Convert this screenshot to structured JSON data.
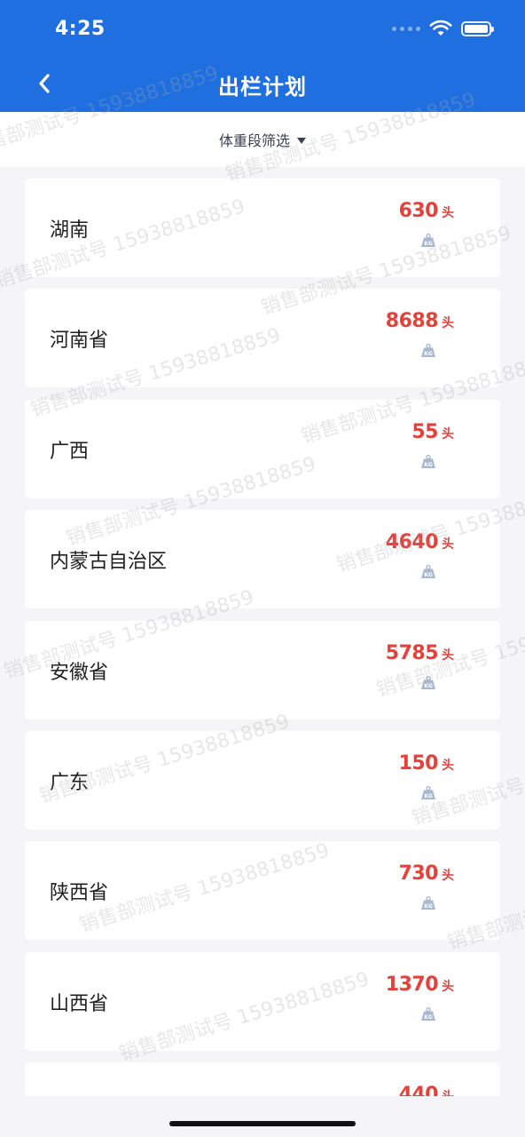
{
  "status_bar": {
    "time": "4:25"
  },
  "header": {
    "title": "出栏计划",
    "back_icon": "chevron-left-icon",
    "background": "#1f6fe0"
  },
  "filter": {
    "label": "体重段筛选",
    "icon": "caret-down-icon"
  },
  "colors": {
    "count": "#e5403a",
    "kg_icon": "#a9b8d0"
  },
  "items": [
    {
      "name": "湖南",
      "count": "630",
      "unit": "头"
    },
    {
      "name": "河南省",
      "count": "8688",
      "unit": "头"
    },
    {
      "name": "广西",
      "count": "55",
      "unit": "头"
    },
    {
      "name": "内蒙古自治区",
      "count": "4640",
      "unit": "头"
    },
    {
      "name": "安徽省",
      "count": "5785",
      "unit": "头"
    },
    {
      "name": "广东",
      "count": "150",
      "unit": "头"
    },
    {
      "name": "陕西省",
      "count": "730",
      "unit": "头"
    },
    {
      "name": "山西省",
      "count": "1370",
      "unit": "头"
    },
    {
      "name": "",
      "count": "440",
      "unit": "头"
    }
  ],
  "watermark": "销售部测试号 15938818859"
}
